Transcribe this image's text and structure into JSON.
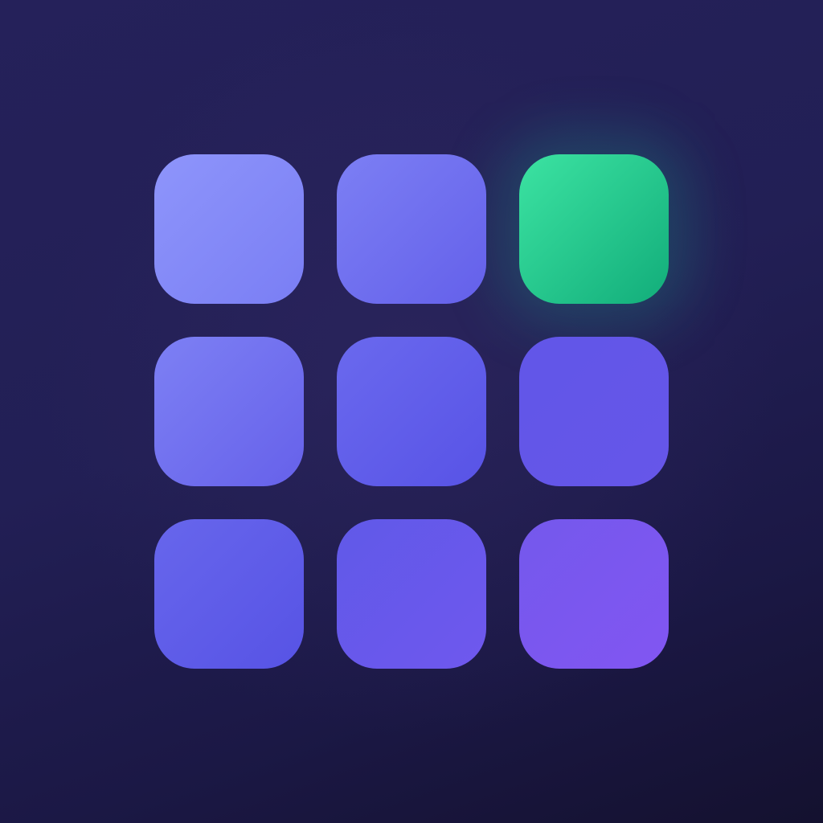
{
  "app_icon": {
    "icon": "grid-icon",
    "colors": {
      "background_top": "#25215a",
      "background_bottom": "#14112f",
      "tile_light": "#8e95fb",
      "tile_mid": "#5853e6",
      "tile_violet": "#8256f2",
      "active_tile_top": "#3ce3a2",
      "active_tile_bottom": "#12ad7a"
    },
    "grid": {
      "rows": 3,
      "columns": 3,
      "active_tile": {
        "row": 1,
        "column": 3
      }
    }
  }
}
